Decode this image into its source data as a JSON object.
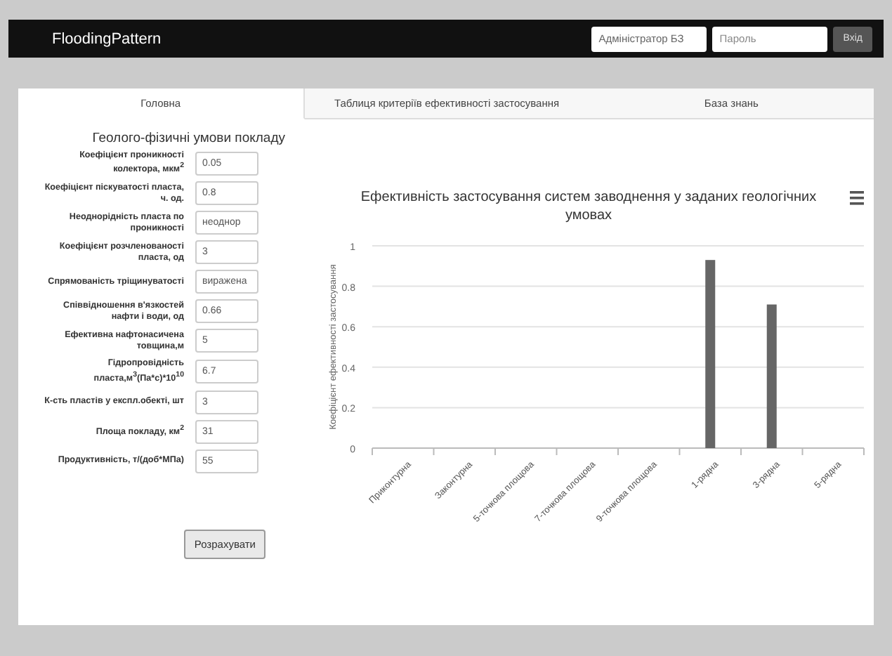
{
  "navbar": {
    "brand": "FloodingPattern",
    "login": {
      "value": "Адміністратор БЗ"
    },
    "password": {
      "placeholder": "Пароль"
    },
    "button": "Вхід"
  },
  "tabs": [
    {
      "label": "Головна",
      "selected": true
    },
    {
      "label": "Таблиця критеріїв ефективності застосування",
      "selected": false
    },
    {
      "label": "База знань",
      "selected": false
    }
  ],
  "form": {
    "title": "Геолого-фізичні умови покладу",
    "fields": [
      {
        "label": "Коефіцієнт проникності колектора, мкм$^{2}$",
        "value": "0.05"
      },
      {
        "label": "Коефіцієнт піскуватості пласта, ч. од.",
        "value": "0.8"
      },
      {
        "label": "Неоднорідність пласта по проникності",
        "value": "неоднор"
      },
      {
        "label": "Коефіцієнт розчленованості пласта, од",
        "value": "3"
      },
      {
        "label": "Спрямованість тріщинуватості",
        "value": "виражена"
      },
      {
        "label": "Співвідношення в'язкостей нафти і води, од",
        "value": "0.66"
      },
      {
        "label": "Ефективна нафтонасичена товщина,м",
        "value": "5"
      },
      {
        "label": "Гідропровідність пласта,м$^{3}$(Па*с)*10$^{10}$",
        "value": "6.7"
      },
      {
        "label": "К-сть пластів у експл.обекті, шт",
        "value": "3"
      },
      {
        "label": "Площа покладу, км$^{2}$",
        "value": "31"
      },
      {
        "label": "Продуктивність, т/(доб*МПа)",
        "value": "55"
      }
    ],
    "button": "Розрахувати"
  },
  "chart": {
    "chart_data": {
      "type": "bar",
      "title": "Ефективність застосування систем заводнення у заданих геологічних умовах",
      "ylabel": "Коефіцієнт ефективності застосування",
      "categories": [
        "Приконтурна",
        "Законтурна",
        "5-точкова площова",
        "7-точкова площова",
        "9-точкова площова",
        "1-рядна",
        "3-рядна",
        "5-рядна"
      ],
      "grid": true,
      "series": [
        {
          "color": "#666666",
          "values": [
            0,
            0,
            0,
            0,
            0,
            0.93,
            0.71,
            0
          ]
        }
      ],
      "ylim": [
        0,
        1
      ],
      "yticks": [
        0,
        0.2,
        0.4,
        0.6,
        0.8,
        1
      ]
    }
  }
}
